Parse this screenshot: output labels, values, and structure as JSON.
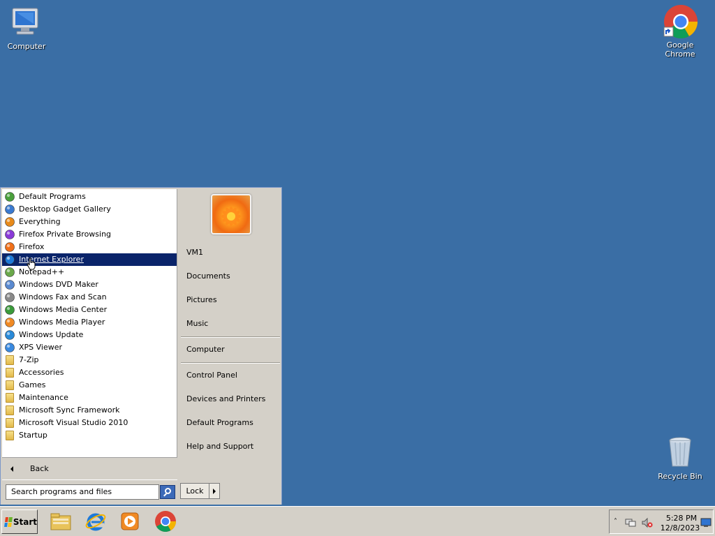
{
  "desktop": {
    "icons": [
      {
        "id": "computer",
        "label": "Computer"
      },
      {
        "id": "chrome",
        "label": "Google Chrome"
      },
      {
        "id": "recycle",
        "label": "Recycle Bin"
      }
    ]
  },
  "start_menu": {
    "programs": [
      {
        "label": "Default Programs",
        "icon": "default-programs-icon"
      },
      {
        "label": "Desktop Gadget Gallery",
        "icon": "gadget-gallery-icon"
      },
      {
        "label": "Everything",
        "icon": "everything-search-icon"
      },
      {
        "label": "Firefox Private Browsing",
        "icon": "firefox-private-icon"
      },
      {
        "label": "Firefox",
        "icon": "firefox-icon"
      },
      {
        "label": "Internet Explorer",
        "icon": "internet-explorer-icon",
        "selected": true
      },
      {
        "label": "Notepad++",
        "icon": "notepad-plus-plus-icon"
      },
      {
        "label": "Windows DVD Maker",
        "icon": "dvd-maker-icon"
      },
      {
        "label": "Windows Fax and Scan",
        "icon": "fax-scan-icon"
      },
      {
        "label": "Windows Media Center",
        "icon": "media-center-icon"
      },
      {
        "label": "Windows Media Player",
        "icon": "media-player-icon"
      },
      {
        "label": "Windows Update",
        "icon": "windows-update-icon"
      },
      {
        "label": "XPS Viewer",
        "icon": "xps-viewer-icon"
      },
      {
        "label": "7-Zip",
        "icon": "folder-icon"
      },
      {
        "label": "Accessories",
        "icon": "folder-icon"
      },
      {
        "label": "Games",
        "icon": "folder-icon"
      },
      {
        "label": "Maintenance",
        "icon": "folder-icon"
      },
      {
        "label": "Microsoft Sync Framework",
        "icon": "folder-icon"
      },
      {
        "label": "Microsoft Visual Studio 2010",
        "icon": "folder-icon"
      },
      {
        "label": "Startup",
        "icon": "folder-icon"
      }
    ],
    "back_label": "Back",
    "search_placeholder": "Search programs and files",
    "right": {
      "user_name": "VM1",
      "documents": "Documents",
      "pictures": "Pictures",
      "music": "Music",
      "computer": "Computer",
      "control_panel": "Control Panel",
      "devices": "Devices and Printers",
      "default_programs": "Default Programs",
      "help": "Help and Support"
    },
    "lock_label": "Lock"
  },
  "taskbar": {
    "start_label": "Start",
    "pinned": [
      "file-explorer-icon",
      "internet-explorer-icon",
      "media-player-icon",
      "chrome-icon"
    ],
    "clock": {
      "time": "5:28 PM",
      "date": "12/8/2023"
    }
  },
  "colors": {
    "desktop": "#3a6ea5",
    "selection": "#0a246a"
  }
}
